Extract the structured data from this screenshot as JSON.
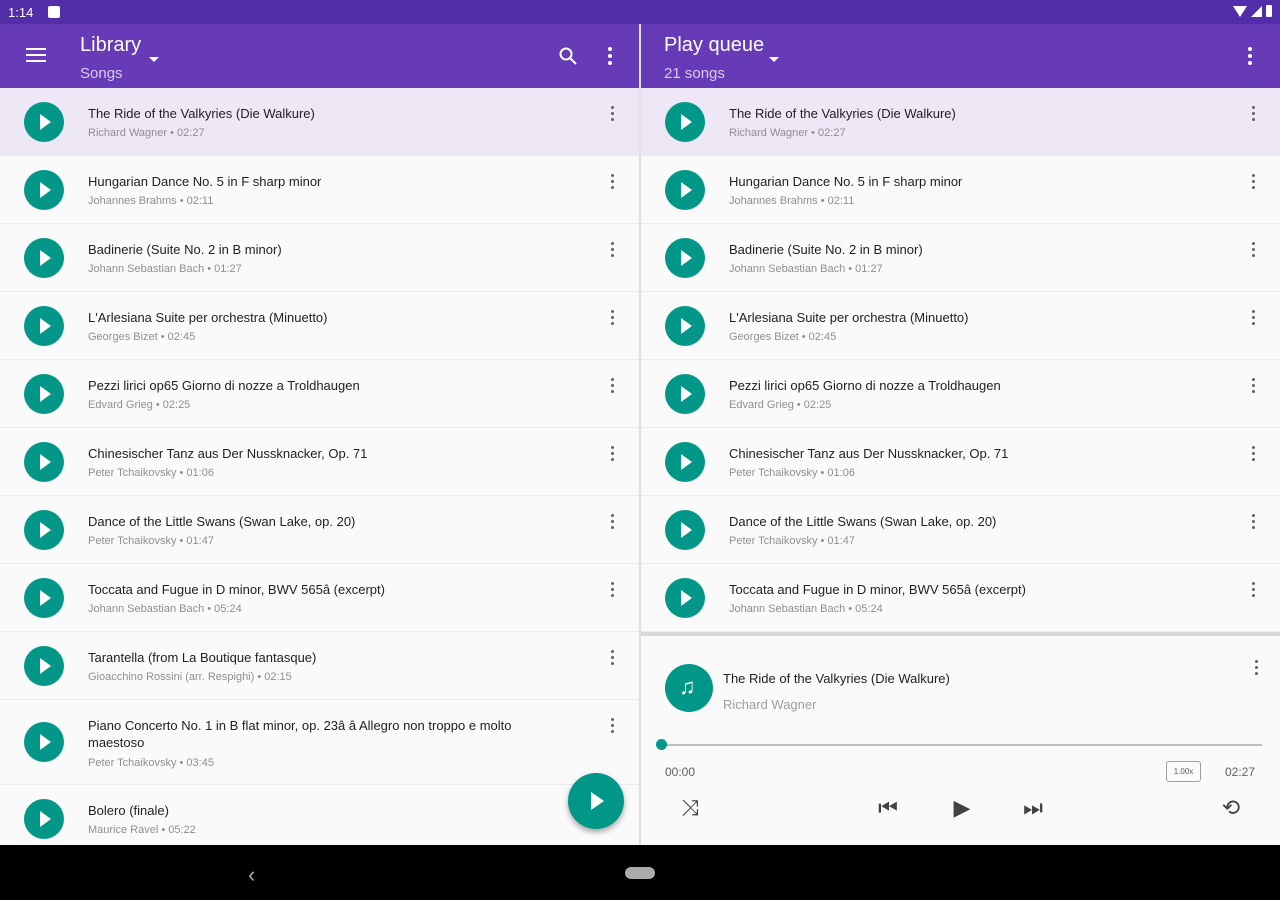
{
  "status": {
    "time": "1:14"
  },
  "library": {
    "title": "Library",
    "subtitle": "Songs"
  },
  "queue": {
    "title": "Play queue",
    "subtitle": "21 songs"
  },
  "library_songs": [
    {
      "title": "The Ride of the Valkyries (Die Walkure)",
      "meta": "Richard Wagner • 02:27"
    },
    {
      "title": "Hungarian Dance No. 5 in F sharp minor",
      "meta": "Johannes Brahms • 02:11"
    },
    {
      "title": "Badinerie (Suite No. 2 in B minor)",
      "meta": "Johann Sebastian Bach • 01:27"
    },
    {
      "title": "L'Arlesiana Suite per orchestra (Minuetto)",
      "meta": "Georges Bizet • 02:45"
    },
    {
      "title": "Pezzi lirici op65 Giorno di nozze a Troldhaugen",
      "meta": "Edvard Grieg • 02:25"
    },
    {
      "title": "Chinesischer Tanz aus Der Nussknacker, Op. 71",
      "meta": "Peter Tchaikovsky • 01:06"
    },
    {
      "title": "Dance of the Little Swans (Swan Lake, op. 20)",
      "meta": "Peter Tchaikovsky • 01:47"
    },
    {
      "title": "Toccata and Fugue in D minor, BWV 565â (excerpt)",
      "meta": "Johann Sebastian Bach • 05:24"
    },
    {
      "title": "Tarantella (from La Boutique fantasque)",
      "meta": "Gioacchino Rossini (arr. Respighi) • 02:15"
    },
    {
      "title": "Piano Concerto No. 1 in B flat minor, op. 23â  â Allegro non troppo e molto maestoso",
      "meta": "Peter Tchaikovsky • 03:45"
    },
    {
      "title": "Bolero (finale)",
      "meta": "Maurice Ravel • 05:22"
    }
  ],
  "queue_songs": [
    {
      "title": "The Ride of the Valkyries (Die Walkure)",
      "meta": "Richard Wagner • 02:27"
    },
    {
      "title": "Hungarian Dance No. 5 in F sharp minor",
      "meta": "Johannes Brahms • 02:11"
    },
    {
      "title": "Badinerie (Suite No. 2 in B minor)",
      "meta": "Johann Sebastian Bach • 01:27"
    },
    {
      "title": "L'Arlesiana Suite per orchestra (Minuetto)",
      "meta": "Georges Bizet • 02:45"
    },
    {
      "title": "Pezzi lirici op65 Giorno di nozze a Troldhaugen",
      "meta": "Edvard Grieg • 02:25"
    },
    {
      "title": "Chinesischer Tanz aus Der Nussknacker, Op. 71",
      "meta": "Peter Tchaikovsky • 01:06"
    },
    {
      "title": "Dance of the Little Swans (Swan Lake, op. 20)",
      "meta": "Peter Tchaikovsky • 01:47"
    },
    {
      "title": "Toccata and Fugue in D minor, BWV 565â (excerpt)",
      "meta": "Johann Sebastian Bach • 05:24"
    }
  ],
  "player": {
    "title": "The Ride of the Valkyries (Die Walkure)",
    "artist": "Richard Wagner",
    "current": "00:00",
    "total": "02:27",
    "speed": "1.00x",
    "progress": 0
  }
}
